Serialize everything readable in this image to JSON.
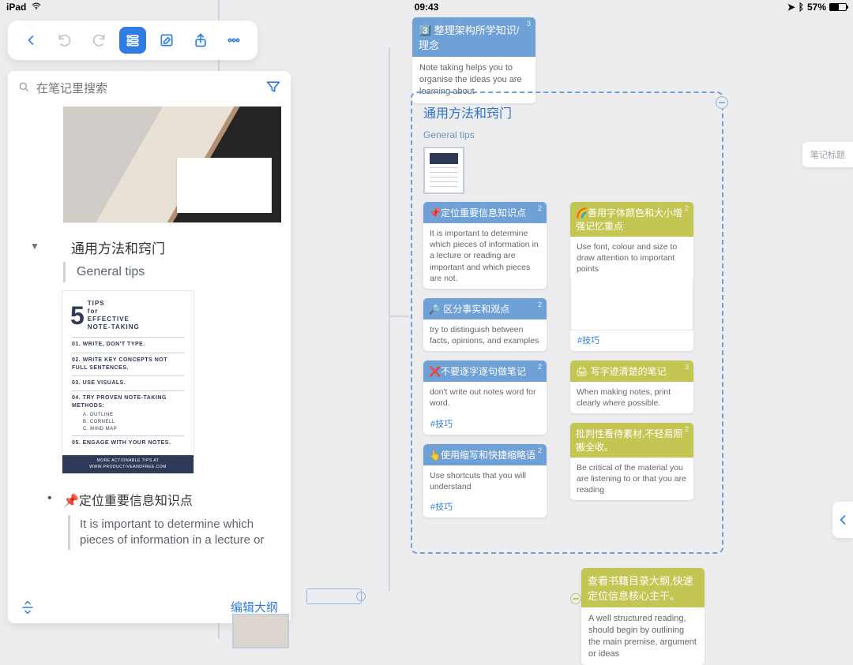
{
  "status": {
    "device": "iPad",
    "time": "09:43",
    "battery_pct": "57%",
    "battery_fill": 57
  },
  "toolbar": {},
  "search": {
    "placeholder": "在笔记里搜索"
  },
  "sidebar": {
    "node1": {
      "title": "通用方法和窍门",
      "subtitle": "General tips"
    },
    "tipscard": {
      "number": "5",
      "heading": "TIPS\nfor\nEFFECTIVE\nNOTE-TAKING",
      "items": [
        "01. WRITE, DON'T TYPE.",
        "02. WRITE KEY CONCEPTS NOT FULL SENTENCES.",
        "03. USE VISUALS.",
        "04. TRY PROVEN NOTE-TAKING METHODS:",
        "05. ENGAGE WITH YOUR NOTES."
      ],
      "subitems": "A. OUTLINE\nB. CORNELL\nC. MIND MAP",
      "footer": "MORE ACTIONABLE TIPS AT WWW.PRODUCTIVEANDFREE.COM"
    },
    "node2": {
      "title": "📌定位重要信息知识点",
      "desc": "It is important to determine which pieces of information in a lecture or"
    },
    "edit": "编辑大纲"
  },
  "topcard": {
    "title": "3️⃣ 整理架构所学知识/理念",
    "body": "Note taking helps you to organise the ideas you are learning about",
    "badge": "3"
  },
  "group": {
    "title": "通用方法和窍门",
    "subtitle": "General tips",
    "colA": [
      {
        "hd": "📌定位重要信息知识点",
        "badge": "2",
        "bd": "It is important to determine which pieces of information in a lecture or reading are important and which pieces are not.",
        "cls": "hd-blue"
      },
      {
        "hd": "🔎 区分事实和观点",
        "badge": "2",
        "bd": "try to distinguish between facts, opinions, and examples",
        "cls": "hd-blue"
      },
      {
        "hd": "❌不要逐字逐句做笔记",
        "badge": "2",
        "bd": "don't write out notes word for word.",
        "tag": "#技巧",
        "cls": "hd-blue"
      },
      {
        "hd": "👆使用缩写和快捷缩略语",
        "badge": "2",
        "bd": "Use shortcuts that you will understand",
        "tag": "#技巧",
        "cls": "hd-blue"
      }
    ],
    "colB": [
      {
        "hd": "🌈善用字体颜色和大小增强记忆重点",
        "badge": "2",
        "bd": "Use font, colour and size to draw attention to important points",
        "pic": true,
        "tag": "#技巧",
        "cls": "hd-olive"
      },
      {
        "hd": "🖨 写字迹清楚的笔记",
        "badge": "3",
        "bd": "When making notes, print clearly where possible.",
        "cls": "hd-olive"
      },
      {
        "hd": "批判性看待素材,不轻易照搬全收。",
        "badge": "2",
        "bd": "Be critical of the material you are listening to or that you are reading",
        "cls": "hd-olive"
      }
    ]
  },
  "bottomcard": {
    "hd": "查看书籍目录大纲,快速定位信息核心主干。",
    "bd": "A well structured reading, should begin by outlining the main premise, argument or ideas"
  },
  "notelabel": "笔记标题"
}
